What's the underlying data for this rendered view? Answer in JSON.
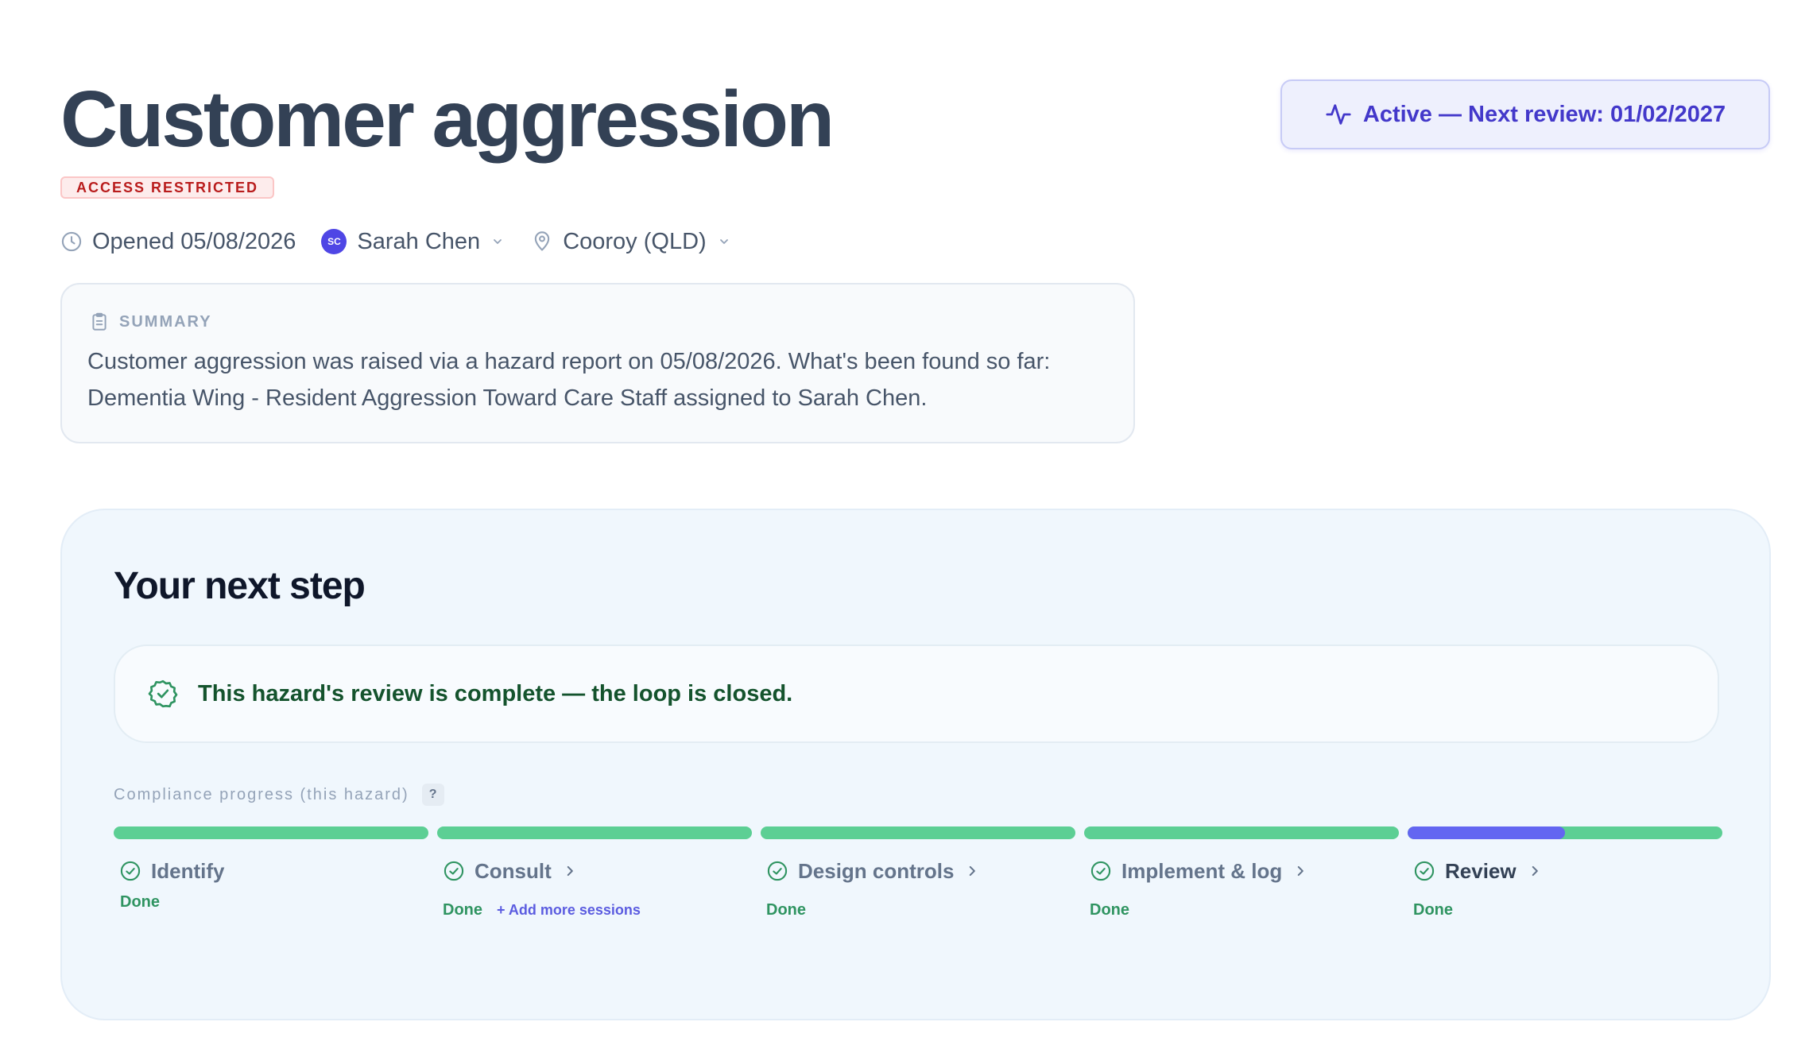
{
  "header": {
    "title": "Customer aggression",
    "restricted_badge": "ACCESS RESTRICTED",
    "status_pill": "Active — Next review: 01/02/2027",
    "opened": "Opened 05/08/2026",
    "assignee": {
      "initials": "SC",
      "name": "Sarah Chen"
    },
    "location": "Cooroy (QLD)"
  },
  "summary": {
    "label": "SUMMARY",
    "text": "Customer aggression was raised via a hazard report on 05/08/2026. What's been found so far: Dementia Wing - Resident Aggression Toward Care Staff assigned to Sarah Chen."
  },
  "next_step": {
    "title": "Your next step",
    "message": "This hazard's review is complete — the loop is closed.",
    "progress_label": "Compliance progress (this hazard)",
    "help": "?",
    "steps": [
      {
        "label": "Identify",
        "status": "Done",
        "progress": 1.0
      },
      {
        "label": "Consult",
        "status": "Done",
        "link": "+ Add more sessions",
        "progress": 1.0
      },
      {
        "label": "Design controls",
        "status": "Done",
        "progress": 1.0
      },
      {
        "label": "Implement & log",
        "status": "Done",
        "progress": 1.0
      },
      {
        "label": "Review",
        "status": "Done",
        "progress": 1.0,
        "current_marker": 0.5
      }
    ]
  },
  "colors": {
    "done_green": "#5ccf94",
    "current_indigo": "#6366f1",
    "restricted_red": "#b91c1c",
    "accent_indigo": "#4338ca"
  }
}
